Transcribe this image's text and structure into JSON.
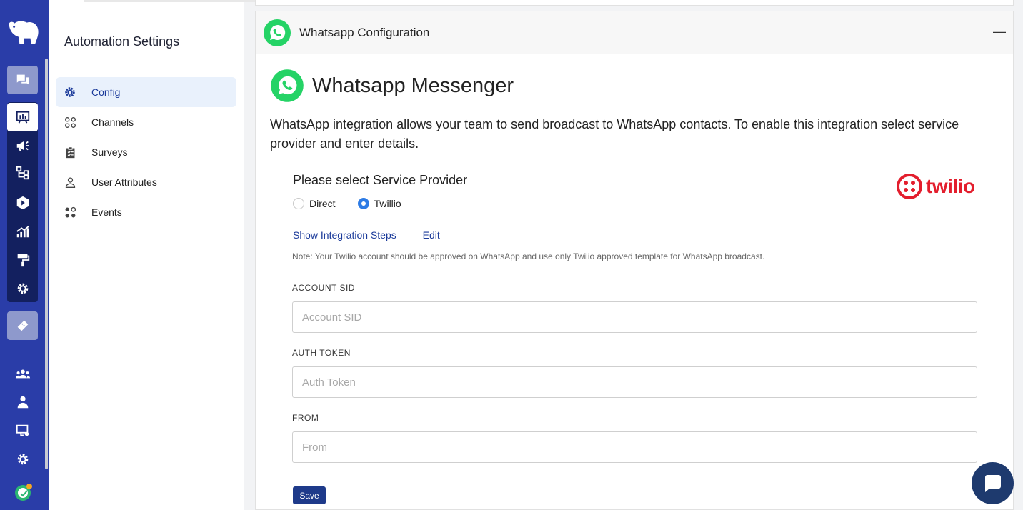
{
  "rail": {
    "items": [
      "logo-icon",
      "chat-icon",
      "dashboard-icon",
      "broadcast-icon",
      "flow-icon",
      "deploy-icon",
      "analytics-icon",
      "paint-roller-icon",
      "settings-icon",
      "ticket-icon",
      "team-icon",
      "user-icon",
      "device-settings-icon",
      "gear-icon",
      "status-avatar-icon"
    ],
    "colors": {
      "rail_bg": "#2a3da8",
      "group_bg": "#13205f",
      "tile_bg": "#8e99cc"
    }
  },
  "sidebar": {
    "title": "Automation Settings",
    "items": [
      {
        "label": "Config",
        "icon": "gear-icon",
        "active": true
      },
      {
        "label": "Channels",
        "icon": "grid-circles-icon",
        "active": false
      },
      {
        "label": "Surveys",
        "icon": "clipboard-icon",
        "active": false
      },
      {
        "label": "User Attributes",
        "icon": "user-icon",
        "active": false
      },
      {
        "label": "Events",
        "icon": "grid-circles-icon",
        "active": false
      }
    ]
  },
  "card": {
    "header_title": "Whatsapp Configuration",
    "collapse_symbol": "—",
    "messenger_title": "Whatsapp Messenger",
    "description": "WhatsApp integration allows your team to send broadcast to WhatsApp contacts. To enable this integration select service provider and enter details.",
    "provider_label": "Please select Service Provider",
    "providers": [
      {
        "label": "Direct",
        "selected": false
      },
      {
        "label": "Twillio",
        "selected": true
      }
    ],
    "provider_logo_text": "twilio",
    "links": {
      "steps": "Show Integration Steps",
      "edit": "Edit"
    },
    "note": "Note: Your Twilio account should be approved on WhatsApp and use only Twilio approved template for WhatsApp broadcast.",
    "fields": [
      {
        "label": "ACCOUNT SID",
        "placeholder": "Account SID",
        "value": ""
      },
      {
        "label": "AUTH TOKEN",
        "placeholder": "Auth Token",
        "value": ""
      },
      {
        "label": "FROM",
        "placeholder": "From",
        "value": ""
      }
    ],
    "save_label": "Save"
  },
  "colors": {
    "whatsapp_green": "#25d366",
    "twilio_red": "#e31e2d",
    "accent": "#1e3a8a",
    "link": "#1a3a9a"
  }
}
